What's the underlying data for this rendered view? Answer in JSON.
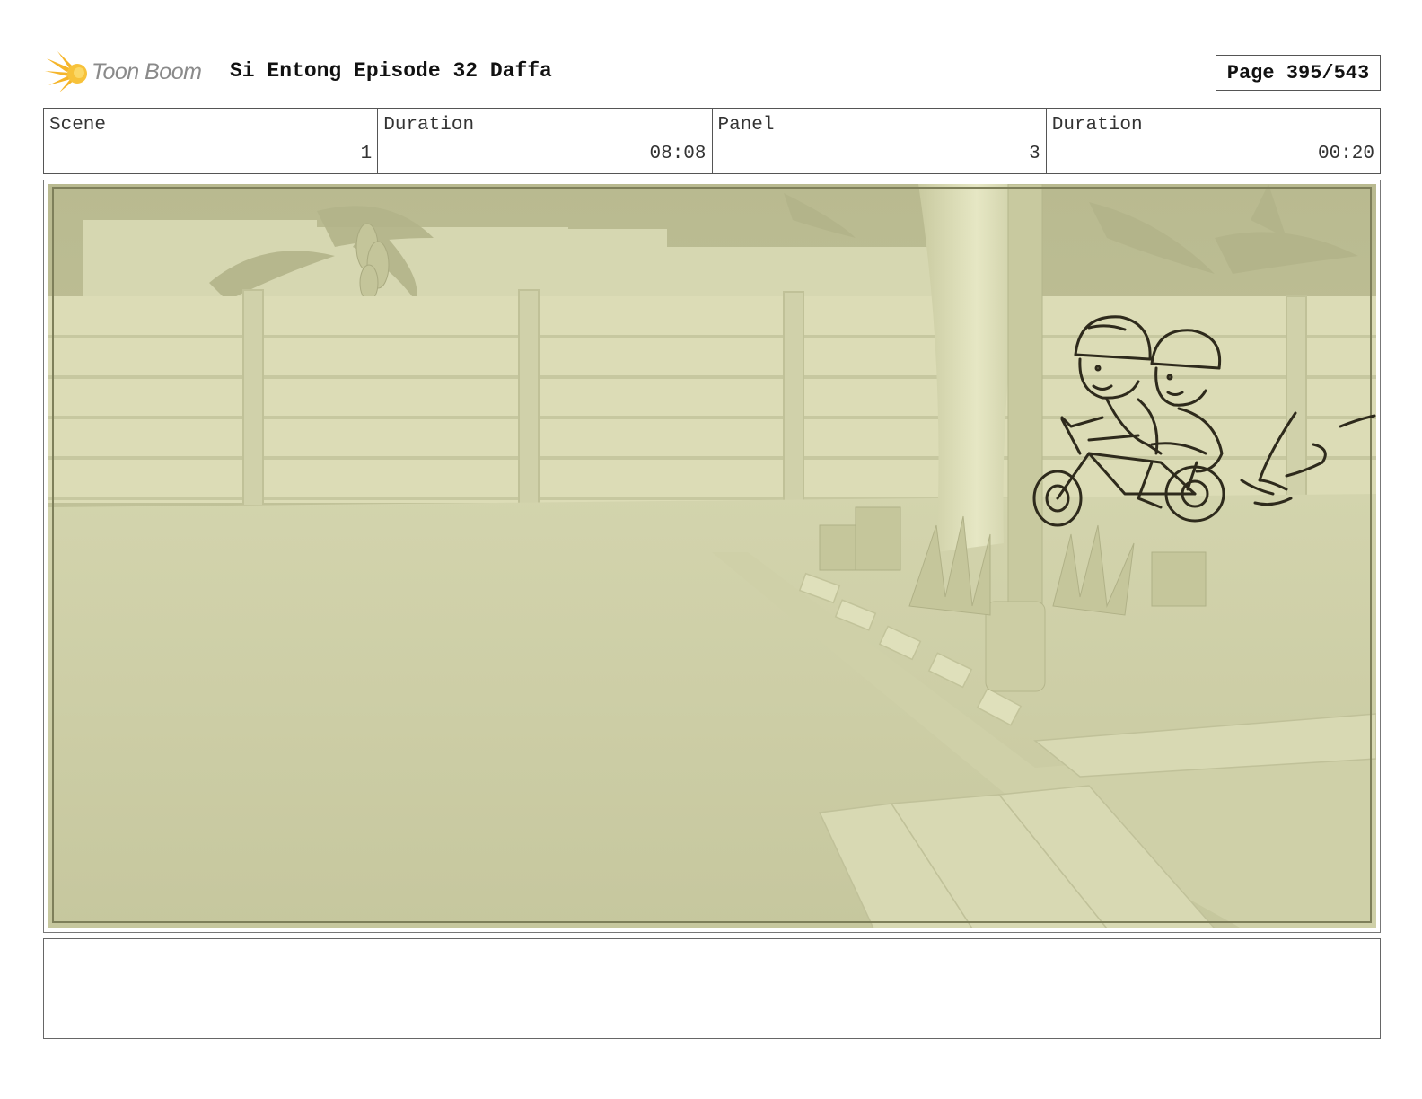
{
  "header": {
    "logo_text": "Toon Boom",
    "title": "Si Entong Episode 32 Daffa",
    "page_label": "Page 395/543"
  },
  "info": {
    "scene_label": "Scene",
    "scene_value": "1",
    "scene_duration_label": "Duration",
    "scene_duration_value": "08:08",
    "panel_label": "Panel",
    "panel_value": "3",
    "panel_duration_label": "Duration",
    "panel_duration_value": "00:20"
  },
  "colors": {
    "panel_tint": "#d4d5ad",
    "sketch_line": "#2e2a1c",
    "logo_orange": "#f5a623"
  },
  "icons": {
    "logo": "starburst-logo-icon"
  }
}
